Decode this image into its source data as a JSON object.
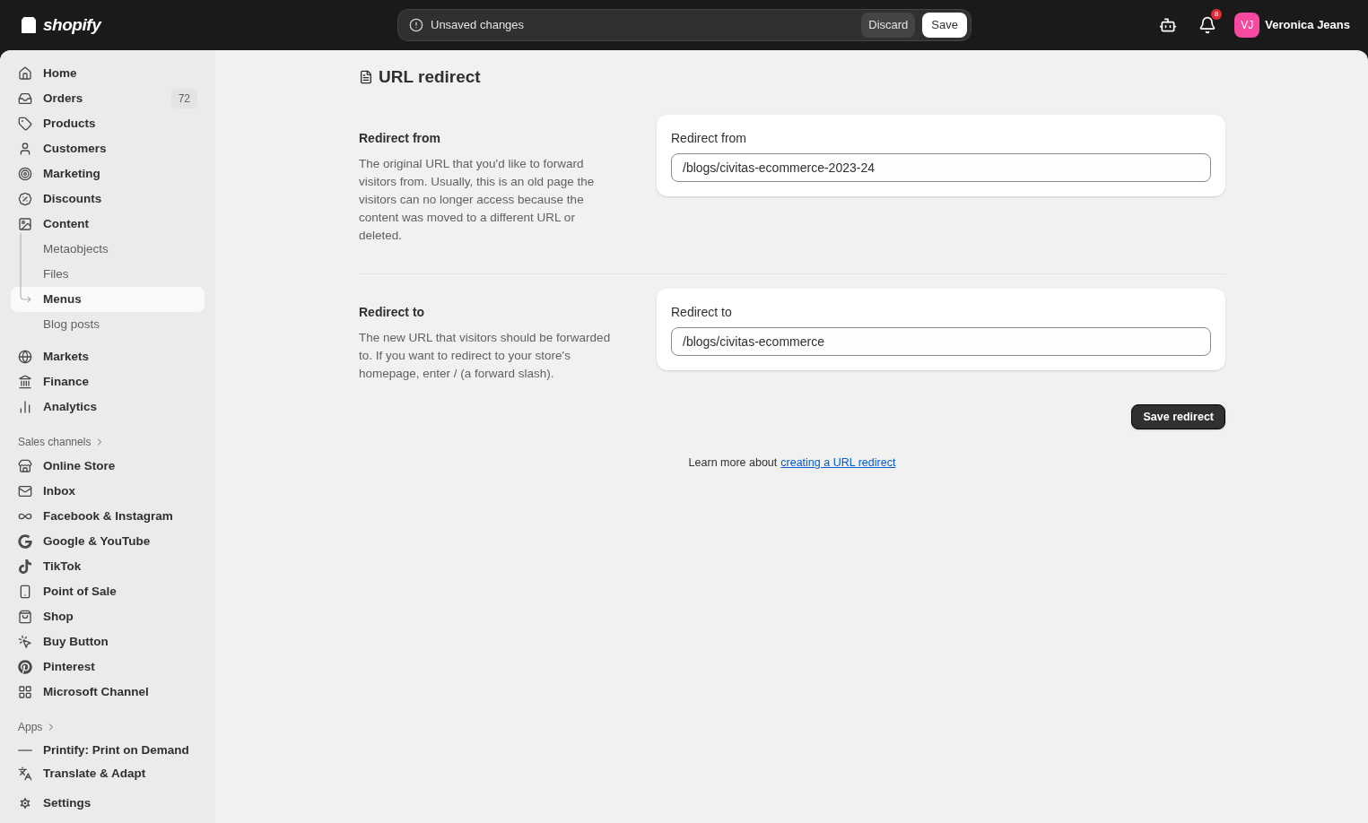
{
  "top_bar": {
    "logo": "shopify",
    "unsaved": {
      "message": "Unsaved changes",
      "discard": "Discard",
      "save": "Save"
    },
    "notifications": "8",
    "user": {
      "initials": "VJ",
      "name": "Veronica Jeans",
      "color": "#f7499f"
    }
  },
  "sidebar": {
    "items": [
      {
        "label": "Home",
        "selected": false
      },
      {
        "label": "Orders",
        "badge": "72",
        "selected": false
      },
      {
        "label": "Products",
        "selected": false
      },
      {
        "label": "Customers",
        "selected": false
      },
      {
        "label": "Marketing",
        "selected": false
      },
      {
        "label": "Discounts",
        "selected": false
      },
      {
        "label": "Content",
        "selected": false,
        "children": [
          {
            "label": "Metaobjects",
            "selected": false
          },
          {
            "label": "Files",
            "selected": false
          },
          {
            "label": "Menus",
            "selected": true
          },
          {
            "label": "Blog posts",
            "selected": false
          }
        ]
      },
      {
        "label": "Markets",
        "selected": false
      },
      {
        "label": "Finance",
        "selected": false
      },
      {
        "label": "Analytics",
        "selected": false
      }
    ],
    "sales_channels": {
      "heading": "Sales channels",
      "items": [
        "Online Store",
        "Inbox",
        "Facebook & Instagram",
        "Google & YouTube",
        "TikTok",
        "Point of Sale",
        "Shop",
        "Buy Button",
        "Pinterest",
        "Microsoft Channel"
      ]
    },
    "apps": {
      "heading": "Apps",
      "items": [
        "Printify: Print on Demand",
        "Translate & Adapt"
      ]
    },
    "settings": "Settings"
  },
  "page": {
    "title": "URL redirect",
    "sections": [
      {
        "heading": "Redirect from",
        "description": "The original URL that you'd like to forward visitors from. Usually, this is an old page the visitors can no longer access because the content was moved to a different URL or deleted.",
        "field_label": "Redirect from",
        "value": "/blogs/civitas-ecommerce-2023-24"
      },
      {
        "heading": "Redirect to",
        "description": "The new URL that visitors should be forwarded to. If you want to redirect to your store's homepage, enter / (a forward slash).",
        "field_label": "Redirect to",
        "value": "/blogs/civitas-ecommerce"
      }
    ],
    "save_button": "Save redirect",
    "learn_more": {
      "text": "Learn more about",
      "link": "creating a URL redirect"
    }
  }
}
